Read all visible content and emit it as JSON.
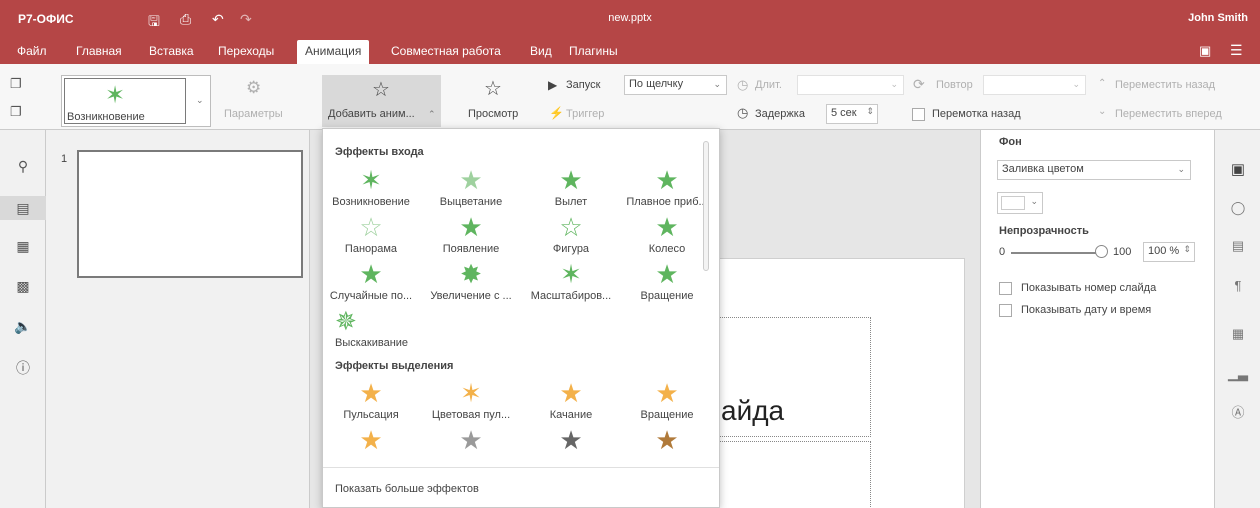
{
  "app": {
    "logo": "Р7-ОФИС",
    "filename": "new.pptx",
    "user": "John Smith"
  },
  "menu": {
    "items": [
      "Файл",
      "Главная",
      "Вставка",
      "Переходы",
      "Анимация",
      "Совместная работа",
      "Вид",
      "Плагины"
    ],
    "active": "Анимация"
  },
  "toolbar": {
    "effect_name": "Возникновение",
    "parameters": "Параметры",
    "add_animation": "Добавить аним...",
    "preview": "Просмотр",
    "start_label": "Запуск",
    "start_value": "По щелчку",
    "trigger": "Триггер",
    "duration_label": "Длит.",
    "delay_label": "Задержка",
    "delay_value": "5 сек",
    "repeat_label": "Повтор",
    "rewind_label": "Перемотка назад",
    "move_back": "Переместить назад",
    "move_forward": "Переместить вперед"
  },
  "thumbnails": {
    "slide_number": "1"
  },
  "slide": {
    "title_fragment": "айда"
  },
  "dropdown": {
    "entrance_header": "Эффекты входа",
    "entrance": [
      "Возникновение",
      "Выцветание",
      "Вылет",
      "Плавное приб...",
      "Панорама",
      "Появление",
      "Фигура",
      "Колесо",
      "Случайные по...",
      "Увеличение с ...",
      "Масштабиров...",
      "Вращение",
      "Выскакивание"
    ],
    "emphasis_header": "Эффекты выделения",
    "emphasis": [
      "Пульсация",
      "Цветовая пул...",
      "Качание",
      "Вращение"
    ],
    "more_effects": "Показать больше эффектов"
  },
  "right_panel": {
    "background_label": "Фон",
    "fill_value": "Заливка цветом",
    "opacity_label": "Непрозрачность",
    "slider_min": "0",
    "slider_max": "100",
    "opacity_value": "100 %",
    "opacity_fraction": 1.0,
    "show_slide_number": "Показывать номер слайда",
    "show_date_time": "Показывать дату и время"
  },
  "colors": {
    "brand": "#b54646",
    "star_green": "#5fb55f",
    "star_orange": "#f3b14a"
  }
}
